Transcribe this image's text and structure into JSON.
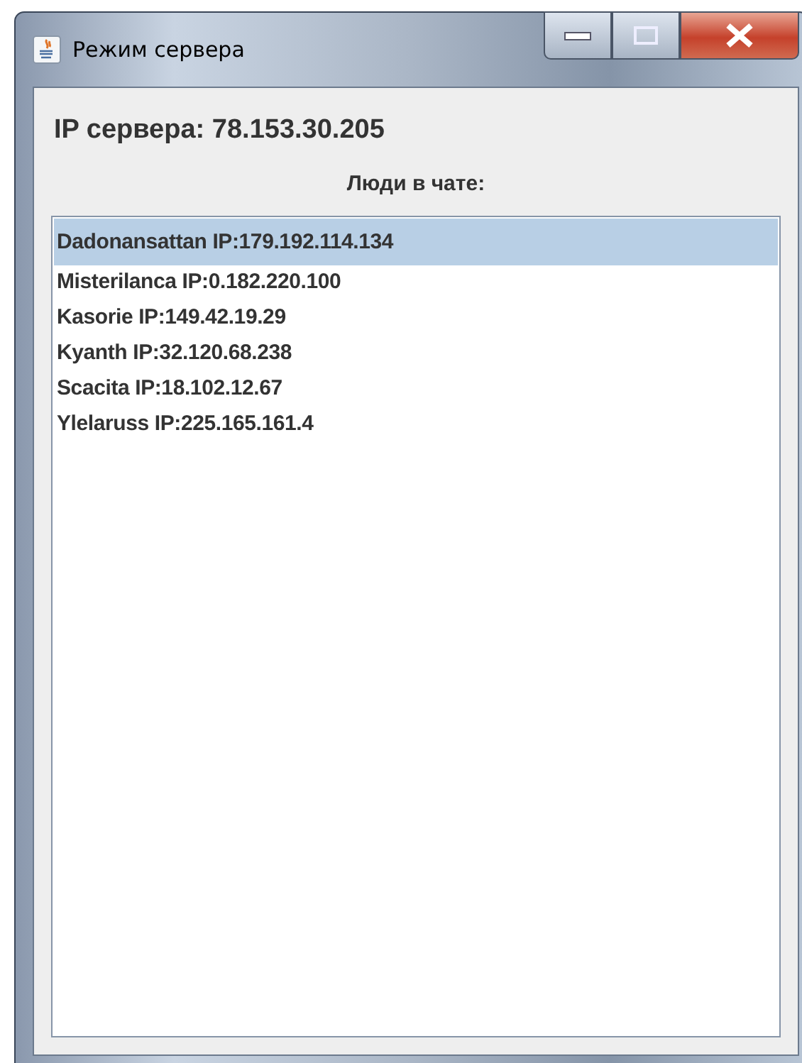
{
  "window": {
    "title": "Режим сервера"
  },
  "server_ip": "IP сервера: 78.153.30.205",
  "list_caption": "Люди в чате:",
  "people": [
    {
      "text": "Dadonansattan IP:179.192.114.134",
      "selected": true
    },
    {
      "text": "Misterilanca IP:0.182.220.100",
      "selected": false
    },
    {
      "text": "Kasorie IP:149.42.19.29",
      "selected": false
    },
    {
      "text": "Kyanth IP:32.120.68.238",
      "selected": false
    },
    {
      "text": "Scacita IP:18.102.12.67",
      "selected": false
    },
    {
      "text": "Ylelaruss IP:225.165.161.4",
      "selected": false
    }
  ]
}
